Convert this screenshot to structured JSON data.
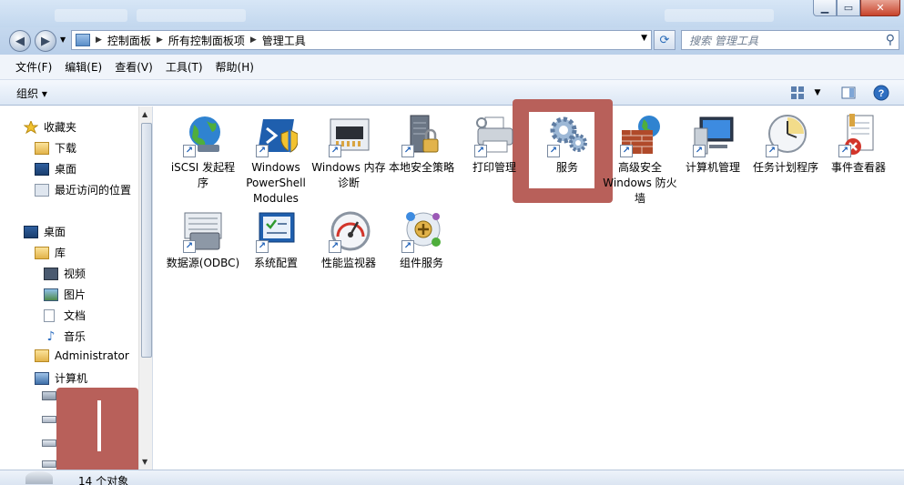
{
  "window": {
    "title": ""
  },
  "address": {
    "breadcrumb": [
      "控制面板",
      "所有控制面板项",
      "管理工具"
    ],
    "search_placeholder": "搜索 管理工具"
  },
  "window_buttons": [
    "minimize",
    "maximize",
    "close"
  ],
  "menu": [
    "文件(F)",
    "编辑(E)",
    "查看(V)",
    "工具(T)",
    "帮助(H)"
  ],
  "command": {
    "organize_label": "组织 ▾"
  },
  "nav": {
    "favorites": {
      "label": "收藏夹",
      "items": [
        "下载",
        "桌面",
        "最近访问的位置"
      ]
    },
    "desktop": "桌面",
    "library": {
      "label": "库",
      "items": [
        "视频",
        "图片",
        "文档",
        "音乐"
      ]
    },
    "admin": "Administrator",
    "computer": "计算机"
  },
  "items": [
    {
      "label": "iSCSI 发起程序",
      "icon": "globe-network-icon"
    },
    {
      "label": "Windows PowerShell Modules",
      "icon": "powershell-icon"
    },
    {
      "label": "Windows 内存诊断",
      "icon": "memory-chip-icon"
    },
    {
      "label": "本地安全策略",
      "icon": "server-lock-icon"
    },
    {
      "label": "打印管理",
      "icon": "printer-icon"
    },
    {
      "label": "服务",
      "icon": "gears-icon"
    },
    {
      "label": "高级安全 Windows 防火墙",
      "icon": "firewall-icon"
    },
    {
      "label": "计算机管理",
      "icon": "computer-management-icon"
    },
    {
      "label": "任务计划程序",
      "icon": "clock-icon"
    },
    {
      "label": "事件查看器",
      "icon": "event-viewer-icon"
    },
    {
      "label": "数据源(ODBC)",
      "icon": "database-icon"
    },
    {
      "label": "系统配置",
      "icon": "system-config-icon"
    },
    {
      "label": "性能监视器",
      "icon": "gauge-icon"
    },
    {
      "label": "组件服务",
      "icon": "component-services-icon"
    }
  ],
  "status": {
    "count": "14 个对象"
  },
  "colors": {
    "annotation": "#b8605a",
    "accent": "#2b6cb8"
  }
}
